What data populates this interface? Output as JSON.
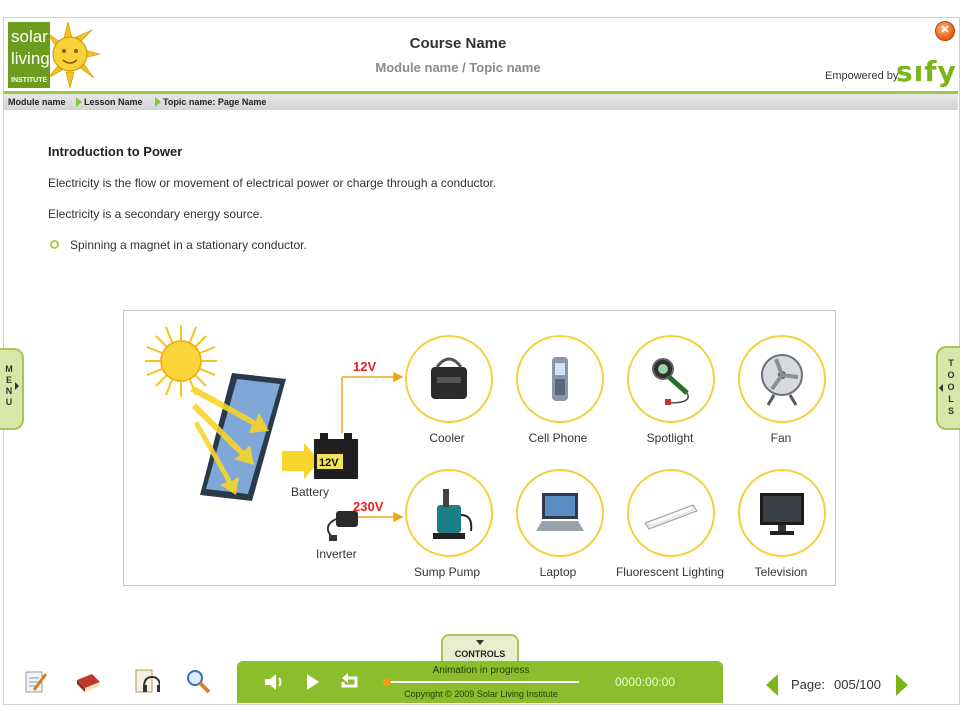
{
  "header": {
    "logo_text": [
      "solar",
      "living",
      "INSTITUTE"
    ],
    "course_title": "Course Name",
    "module_topic": "Module name / Topic name",
    "empowered_by": "Empowered by",
    "sify_logo": "sıfy",
    "close_icon": "close-icon"
  },
  "breadcrumb": [
    "Module name",
    "Lesson Name",
    "Topic name: Page Name"
  ],
  "content": {
    "title": "Introduction to Power",
    "paragraphs": [
      "Electricity is the flow or movement of electrical power or charge through a conductor.",
      "Electricity is a secondary energy source."
    ],
    "bullets": [
      "Spinning a magnet in a stationary conductor."
    ]
  },
  "figure": {
    "voltage_top": "12V",
    "voltage_bottom": "230V",
    "battery_tag": "12V",
    "battery_label": "Battery",
    "inverter_label": "Inverter",
    "devices_top": [
      "Cooler",
      "Cell Phone",
      "Spotlight",
      "Fan"
    ],
    "devices_bottom": [
      "Sump Pump",
      "Laptop",
      "Fluorescent Lighting",
      "Television"
    ]
  },
  "side_tabs": {
    "menu_letters": [
      "M",
      "E",
      "N",
      "U"
    ],
    "tools_letters": [
      "T",
      "O",
      "O",
      "L",
      "S"
    ]
  },
  "bottom_bar": {
    "controls_label": "CONTROLS",
    "tools": [
      "notes-icon",
      "glossary-book-icon",
      "audio-transcript-icon",
      "search-icon"
    ],
    "animation_status": "Animation in progress",
    "copyright": "Copyright © 2009 Solar Living Institute",
    "timecode": "0000:00:00",
    "progress": 0.02,
    "page_label": "Page:",
    "page_number": "005/100"
  },
  "colors": {
    "accent_green": "#8bbd2c",
    "volt_red": "#e52222",
    "circle_yellow": "#f4d03f"
  }
}
